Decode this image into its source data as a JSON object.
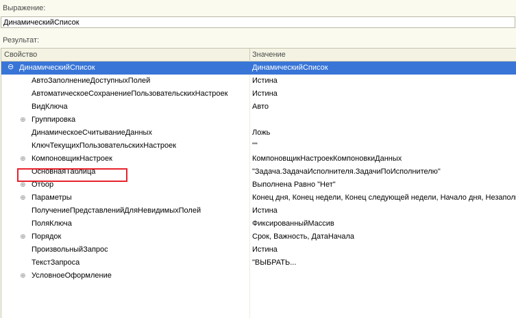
{
  "expression": {
    "label": "Выражение:",
    "value": "ДинамическийСписок"
  },
  "result": {
    "label": "Результат:"
  },
  "grid": {
    "col_property": "Свойство",
    "col_value": "Значение",
    "rows": [
      {
        "name": "ДинамическийСписок",
        "value": "ДинамическийСписок",
        "toggle": "⊖"
      },
      {
        "name": "АвтоЗаполнениеДоступныхПолей",
        "value": "Истина"
      },
      {
        "name": "АвтоматическоеСохранениеПользовательскихНастроек",
        "value": "Истина"
      },
      {
        "name": "ВидКлюча",
        "value": "Авто"
      },
      {
        "name": "Группировка",
        "value": "",
        "toggle": "⊕"
      },
      {
        "name": "ДинамическоеСчитываниеДанных",
        "value": "Ложь"
      },
      {
        "name": "КлючТекущихПользовательскихНастроек",
        "value": "\"\""
      },
      {
        "name": "КомпоновщикНастроек",
        "value": "КомпоновщикНастроекКомпоновкиДанных",
        "toggle": "⊕"
      },
      {
        "name": "ОсновнаяТаблица",
        "value": "\"Задача.ЗадачаИсполнителя.ЗадачиПоИсполнителю\""
      },
      {
        "name": "Отбор",
        "value": "Выполнена Равно \"Нет\"",
        "toggle": "⊕"
      },
      {
        "name": "Параметры",
        "value": "Конец дня, Конец недели, Конец следующей недели, Начало дня, Незаполн",
        "toggle": "⊕"
      },
      {
        "name": "ПолучениеПредставленийДляНевидимыхПолей",
        "value": "Истина"
      },
      {
        "name": "ПоляКлюча",
        "value": "ФиксированныйМассив"
      },
      {
        "name": "Порядок",
        "value": "Срок, Важность, ДатаНачала",
        "toggle": "⊕"
      },
      {
        "name": "ПроизвольныйЗапрос",
        "value": "Истина"
      },
      {
        "name": "ТекстЗапроса",
        "value": "\"ВЫБРАТЬ..."
      },
      {
        "name": "УсловноеОформление",
        "value": "",
        "toggle": "⊕"
      }
    ]
  }
}
